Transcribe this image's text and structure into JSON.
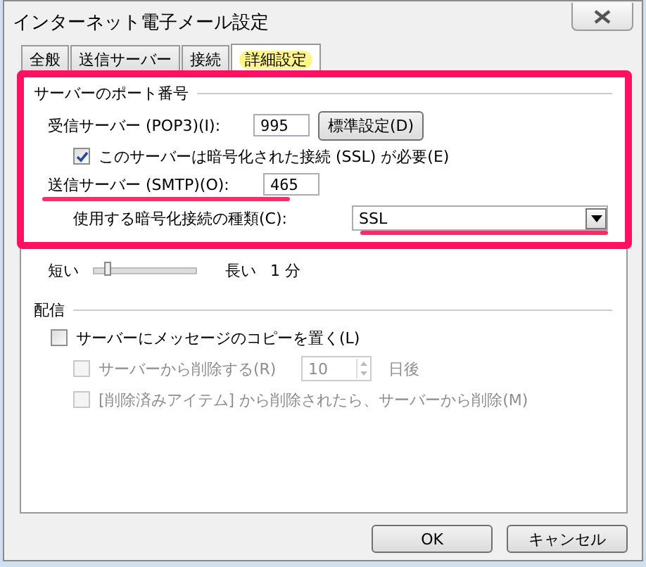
{
  "window": {
    "title": "インターネット電子メール設定"
  },
  "tabs": [
    {
      "label": "全般",
      "selected": false,
      "highlighted": false
    },
    {
      "label": "送信サーバー",
      "selected": false,
      "highlighted": false
    },
    {
      "label": "接続",
      "selected": false,
      "highlighted": false
    },
    {
      "label": "詳細設定",
      "selected": true,
      "highlighted": true
    }
  ],
  "port_section": {
    "title": "サーバーのポート番号",
    "highlighted": true,
    "incoming": {
      "label": "受信サーバー (POP3)(I):",
      "value": "995"
    },
    "default_button": "標準設定(D)",
    "ssl": {
      "label": "このサーバーは暗号化された接続 (SSL) が必要(E)",
      "checked": true
    },
    "outgoing": {
      "label": "送信サーバー (SMTP)(O):",
      "value": "465",
      "underlined": true
    },
    "encryption": {
      "label": "使用する暗号化接続の種類(C):",
      "value": "SSL",
      "underlined": true
    }
  },
  "timeout": {
    "short_label": "短い",
    "level": 0.1,
    "long_label": "長い",
    "value": "1 分"
  },
  "delivery": {
    "title": "配信",
    "keep_copy": {
      "label": "サーバーにメッセージのコピーを置く(L)",
      "checked": false,
      "disabled": false
    },
    "remove_after": {
      "label": "サーバーから削除する(R)",
      "checked": false,
      "disabled": true,
      "days": "10",
      "suffix": "日後"
    },
    "remove_deleted": {
      "label": "[削除済みアイテム] から削除されたら、サーバーから削除(M)",
      "checked": false,
      "disabled": true
    }
  },
  "buttons": [
    {
      "label": "OK"
    },
    {
      "label": "キャンセル"
    }
  ]
}
